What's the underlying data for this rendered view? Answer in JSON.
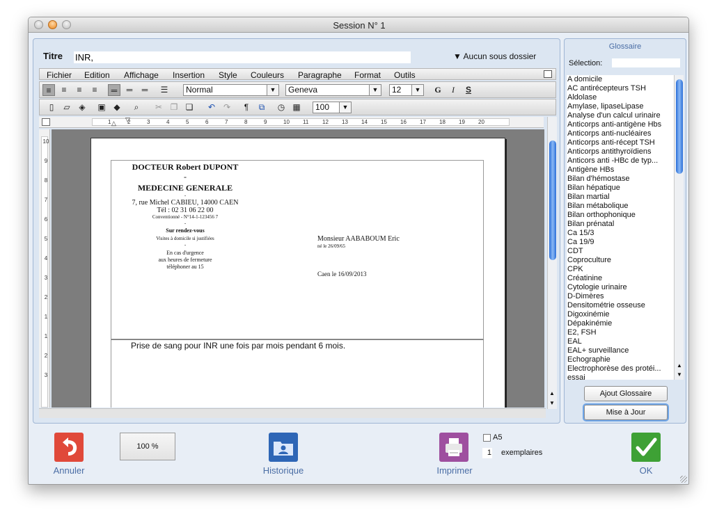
{
  "window": {
    "title": "Session N° 1"
  },
  "titre": {
    "label": "Titre",
    "value": "INR,"
  },
  "subfolder": {
    "label": "▼ Aucun sous dossier"
  },
  "menu": [
    "Fichier",
    "Edition",
    "Affichage",
    "Insertion",
    "Style",
    "Couleurs",
    "Paragraphe",
    "Format",
    "Outils"
  ],
  "format": {
    "style": "Normal",
    "font": "Geneva",
    "size": "12",
    "bold": "G",
    "italic": "I",
    "strike": "S",
    "zoom": "100"
  },
  "ruler": {
    "h_labels": [
      "1",
      "2",
      "3",
      "4",
      "5",
      "6",
      "7",
      "8",
      "9",
      "10",
      "11",
      "12",
      "13",
      "14",
      "15",
      "16",
      "17",
      "18",
      "19",
      "20"
    ],
    "v_labels": [
      "10",
      "9",
      "8",
      "7",
      "6",
      "5",
      "4",
      "3",
      "2",
      "1",
      "1",
      "2",
      "3"
    ]
  },
  "document": {
    "doctor": "DOCTEUR Robert DUPONT",
    "dash1": "-",
    "specialty": "MEDECINE GENERALE",
    "dash2": "-",
    "address": "7, rue Michel CABIEU, 14000 CAEN",
    "phone": "Tél : 02 31 06 22 00",
    "convention": "Conventionné - N°14-1-123456 7",
    "dash3": "-",
    "appointment": "Sur rendez-vous",
    "visits": "Visites à domicile si justifiées",
    "dash4": "-",
    "urgent1": "En cas d'urgence",
    "urgent2": "aux heures de fermeture",
    "urgent3": "téléphoner au 15",
    "patient": "Monsieur AABABOUM Eric",
    "birth": "né le 26/09/65",
    "place_date": "Caen le 16/09/2013",
    "body": "Prise de sang pour INR une fois par mois pendant 6 mois."
  },
  "glossary": {
    "title": "Glossaire",
    "selection_label": "Sélection:",
    "items": [
      "A domicile",
      "AC antirécepteurs TSH",
      "Aldolase",
      "Amylase, lipaseLipase",
      "Analyse d'un calcul urinaire",
      "Anticorps anti-antigène Hbs",
      "Anticorps anti-nucléaires",
      "Anticorps anti-récept TSH",
      "Anticorps antithyroïdiens",
      "Anticors anti -HBc de typ...",
      "Antigène HBs",
      "Bilan d'hémostase",
      "Bilan hépatique",
      "Bilan martial",
      "Bilan métabolique",
      "Bilan orthophonique",
      "Bilan prénatal",
      "Ca 15/3",
      "Ca 19/9",
      "CDT",
      "Coproculture",
      "CPK",
      "Créatinine",
      "Cytologie urinaire",
      "D-Dimères",
      "Densitométrie osseuse",
      "Digoxinémie",
      "Dépakinémie",
      "E2, FSH",
      "EAL",
      "EAL+ surveillance",
      "Echographie",
      "Electrophorèse des protéi...",
      "essai"
    ],
    "add_button": "Ajout Glossaire",
    "update_button": "Mise à Jour"
  },
  "bottom": {
    "cancel": "Annuler",
    "zoom": "100 %",
    "history": "Historique",
    "print": "Imprimer",
    "a5_label": "A5",
    "copies_value": "1",
    "copies_label": "exemplaires",
    "ok": "OK"
  },
  "colors": {
    "accent": "#4a6da5",
    "cancel": "#e0493a",
    "history": "#2e66b6",
    "print": "#9e4f9f",
    "ok": "#3ea135"
  }
}
